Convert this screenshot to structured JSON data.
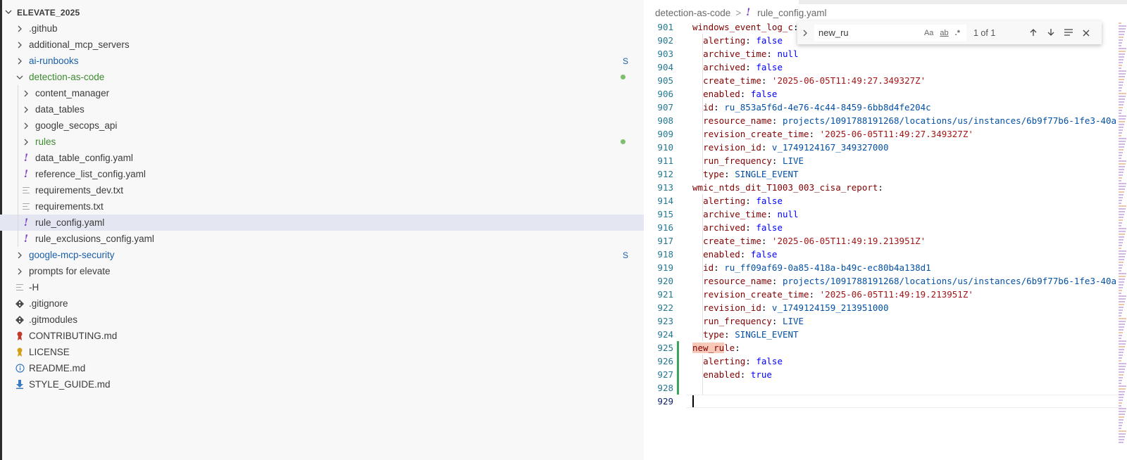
{
  "explorer": {
    "root_label": "ELEVATE_2025",
    "items": [
      {
        "label": ".github",
        "type": "folder-closed"
      },
      {
        "label": "additional_mcp_servers",
        "type": "folder-closed"
      },
      {
        "label": "ai-runbooks",
        "type": "folder-closed",
        "badge": "S"
      },
      {
        "label": "detection-as-code",
        "type": "folder-open"
      },
      {
        "label": "content_manager",
        "type": "folder-closed"
      },
      {
        "label": "data_tables",
        "type": "folder-closed"
      },
      {
        "label": "google_secops_api",
        "type": "folder-closed"
      },
      {
        "label": "rules",
        "type": "folder-closed"
      },
      {
        "label": "data_table_config.yaml",
        "type": "yaml"
      },
      {
        "label": "reference_list_config.yaml",
        "type": "yaml"
      },
      {
        "label": "requirements_dev.txt",
        "type": "text"
      },
      {
        "label": "requirements.txt",
        "type": "text"
      },
      {
        "label": "rule_config.yaml",
        "type": "yaml"
      },
      {
        "label": "rule_exclusions_config.yaml",
        "type": "yaml"
      },
      {
        "label": "google-mcp-security",
        "type": "folder-closed",
        "badge": "S"
      },
      {
        "label": "prompts for elevate",
        "type": "folder-closed"
      },
      {
        "label": "-H",
        "type": "text"
      },
      {
        "label": ".gitignore",
        "type": "git"
      },
      {
        "label": ".gitmodules",
        "type": "git"
      },
      {
        "label": "CONTRIBUTING.md",
        "type": "contributing"
      },
      {
        "label": "LICENSE",
        "type": "license"
      },
      {
        "label": "README.md",
        "type": "info"
      },
      {
        "label": "STYLE_GUIDE.md",
        "type": "download"
      }
    ]
  },
  "editor": {
    "breadcrumb": {
      "folder": "detection-as-code",
      "separator": ">",
      "file_icon": "!",
      "file": "rule_config.yaml"
    },
    "find": {
      "value": "new_ru",
      "opt_case": "Aa",
      "opt_word": "ab",
      "opt_regex": ".*",
      "count": "1 of 1"
    },
    "lines": [
      {
        "n": "901",
        "key": "windows_event_log_c",
        "top": true,
        "value": ""
      },
      {
        "n": "902",
        "key": "alerting",
        "value": "false"
      },
      {
        "n": "903",
        "key": "archive_time",
        "value": "null"
      },
      {
        "n": "904",
        "key": "archived",
        "value": "false"
      },
      {
        "n": "905",
        "key": "create_time",
        "value": "'2025-06-05T11:49:27.349327Z'"
      },
      {
        "n": "906",
        "key": "enabled",
        "value": "false"
      },
      {
        "n": "907",
        "key": "id",
        "value": "ru_853a5f6d-4e76-4c44-8459-6bb8d4fe204c"
      },
      {
        "n": "908",
        "key": "resource_name",
        "value": "projects/1091788191268/locations/us/instances/6b9f77b6-1fe3-40a"
      },
      {
        "n": "909",
        "key": "revision_create_time",
        "value": "'2025-06-05T11:49:27.349327Z'"
      },
      {
        "n": "910",
        "key": "revision_id",
        "value": "v_1749124167_349327000"
      },
      {
        "n": "911",
        "key": "run_frequency",
        "value": "LIVE"
      },
      {
        "n": "912",
        "key": "type",
        "value": "SINGLE_EVENT"
      },
      {
        "n": "913",
        "key": "wmic_ntds_dit_T1003_003_cisa_report",
        "top": true,
        "value": ""
      },
      {
        "n": "914",
        "key": "alerting",
        "value": "false"
      },
      {
        "n": "915",
        "key": "archive_time",
        "value": "null"
      },
      {
        "n": "916",
        "key": "archived",
        "value": "false"
      },
      {
        "n": "917",
        "key": "create_time",
        "value": "'2025-06-05T11:49:19.213951Z'"
      },
      {
        "n": "918",
        "key": "enabled",
        "value": "false"
      },
      {
        "n": "919",
        "key": "id",
        "value": "ru_ff09af69-0a85-418a-b49c-ec80b4a138d1"
      },
      {
        "n": "920",
        "key": "resource_name",
        "value": "projects/1091788191268/locations/us/instances/6b9f77b6-1fe3-40a"
      },
      {
        "n": "921",
        "key": "revision_create_time",
        "value": "'2025-06-05T11:49:19.213951Z'"
      },
      {
        "n": "922",
        "key": "revision_id",
        "value": "v_1749124159_213951000"
      },
      {
        "n": "923",
        "key": "run_frequency",
        "value": "LIVE"
      },
      {
        "n": "924",
        "key": "type",
        "value": "SINGLE_EVENT"
      },
      {
        "n": "925",
        "key": "new_rule",
        "top": true,
        "value": "",
        "match": "new_ru",
        "rest": "le"
      },
      {
        "n": "926",
        "key": "alerting",
        "value": "false"
      },
      {
        "n": "927",
        "key": "enabled",
        "value": "true"
      },
      {
        "n": "928",
        "key": "",
        "value": ""
      },
      {
        "n": "929",
        "key": "",
        "value": ""
      }
    ]
  }
}
